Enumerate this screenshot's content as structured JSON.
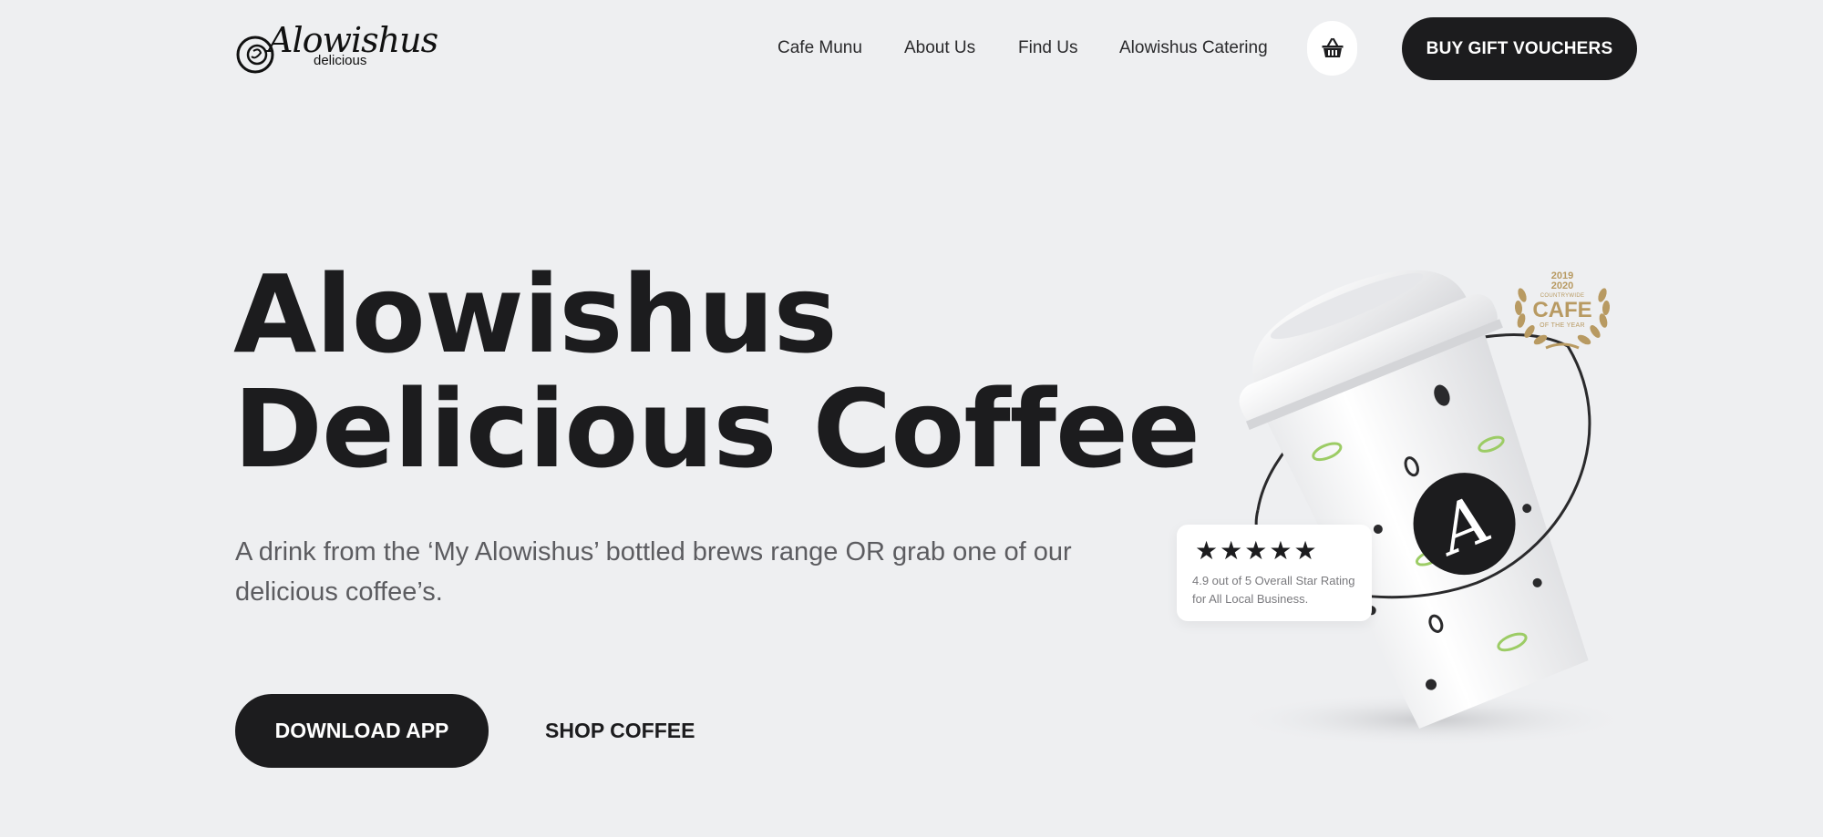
{
  "brand": {
    "logo_script": "Alowishus",
    "logo_sub": "delicious"
  },
  "nav": {
    "links": [
      "Cafe Munu",
      "About Us",
      "Find Us",
      "Alowishus Catering"
    ],
    "basket_icon": "basket-icon",
    "cta_label": "BUY GIFT VOUCHERS"
  },
  "hero": {
    "title_line1": "Alowishus",
    "title_line2": "Delicious Coffee",
    "subtitle": "A drink from the ‘My Alowishus’ bottled brews range OR grab one of our delicious coffee’s.",
    "primary_cta": "DOWNLOAD APP",
    "secondary_cta": "SHOP COFFEE"
  },
  "award": {
    "years": "2019\n2020",
    "small": "COUNTRYWIDE",
    "main": "CAFE",
    "sub": "OF THE YEAR"
  },
  "rating": {
    "stars": 5,
    "text": "4.9 out of 5 Overall Star Rating for All Local Business."
  },
  "colors": {
    "background": "#eeeff1",
    "dark": "#1c1c1e",
    "muted_text": "#5c5c60",
    "gold": "#b89a62",
    "leaf_green": "#9ccc65"
  }
}
